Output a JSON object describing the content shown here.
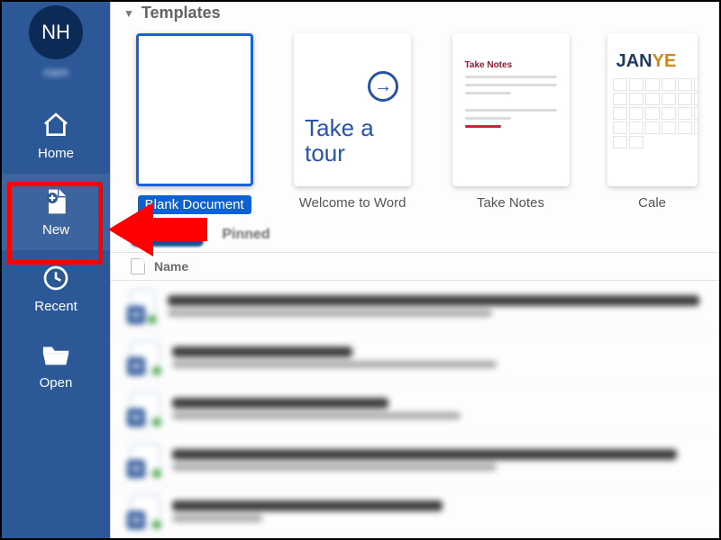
{
  "user": {
    "initials": "NH",
    "name": "nam"
  },
  "sidebar": {
    "items": [
      {
        "id": "home",
        "label": "Home"
      },
      {
        "id": "new",
        "label": "New"
      },
      {
        "id": "recent",
        "label": "Recent"
      },
      {
        "id": "open",
        "label": "Open"
      }
    ]
  },
  "templates": {
    "section_title": "Templates",
    "items": [
      {
        "label": "Blank Document",
        "selected": true
      },
      {
        "label": "Welcome to Word",
        "selected": false,
        "tour_text": "Take a tour"
      },
      {
        "label": "Take Notes",
        "selected": false,
        "notes_title": "Take Notes"
      },
      {
        "label": "Calendar",
        "selected": false,
        "cal_prefix": "JAN",
        "cal_suffix": "YE",
        "label_visible": "Cale"
      }
    ]
  },
  "tabs": {
    "active": "Recent",
    "inactive": "Pinned"
  },
  "list": {
    "header_name": "Name",
    "rows": [
      {
        "title_w": 590,
        "sub_w": 360
      },
      {
        "title_w": 200,
        "sub_w": 360
      },
      {
        "title_w": 240,
        "sub_w": 320
      },
      {
        "title_w": 560,
        "sub_w": 360
      },
      {
        "title_w": 300,
        "sub_w": 100
      }
    ]
  }
}
